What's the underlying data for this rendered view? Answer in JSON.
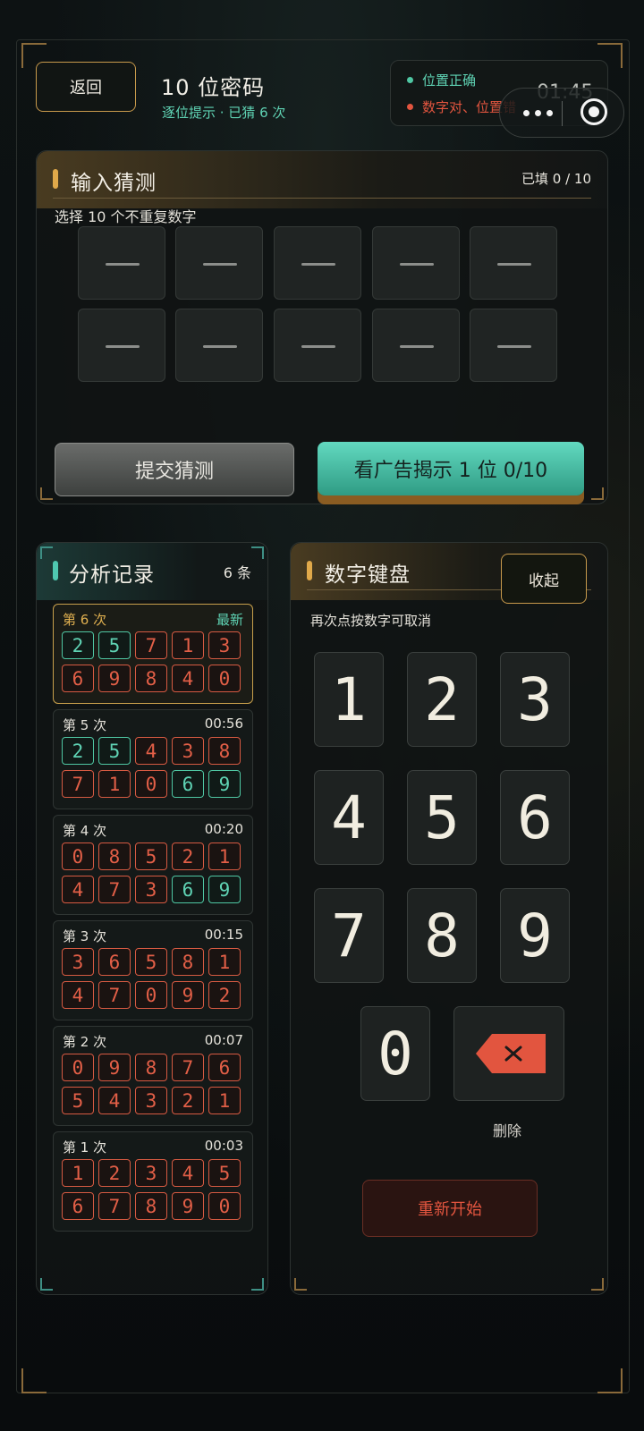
{
  "header": {
    "back_label": "返回",
    "title": "10 位密码",
    "subtitle": "逐位提示 · 已猜 6 次"
  },
  "legend": {
    "correct_label": "位置正确",
    "misplaced_label": "数字对、位置错",
    "correct_color": "#4fc7a3",
    "misplaced_color": "#e2553f"
  },
  "status": {
    "time": "01:45"
  },
  "input_panel": {
    "title": "输入猜测",
    "filled": "已填 0 / 10",
    "hint": "选择 10 个不重复数字",
    "slot_placeholder": "—",
    "submit_label": "提交猜测",
    "ad_label": "看广告揭示 1 位 0/10"
  },
  "history": {
    "title": "分析记录",
    "count": "6 条",
    "entries": [
      {
        "label": "第 6 次",
        "time": "最新",
        "digits": [
          "2",
          "5",
          "7",
          "1",
          "3",
          "6",
          "9",
          "8",
          "4",
          "0"
        ],
        "ok": [
          1,
          1,
          0,
          0,
          0,
          0,
          0,
          0,
          0,
          0
        ]
      },
      {
        "label": "第 5 次",
        "time": "00:56",
        "digits": [
          "2",
          "5",
          "4",
          "3",
          "8",
          "7",
          "1",
          "0",
          "6",
          "9"
        ],
        "ok": [
          1,
          1,
          0,
          0,
          0,
          0,
          0,
          0,
          1,
          1
        ]
      },
      {
        "label": "第 4 次",
        "time": "00:20",
        "digits": [
          "0",
          "8",
          "5",
          "2",
          "1",
          "4",
          "7",
          "3",
          "6",
          "9"
        ],
        "ok": [
          0,
          0,
          0,
          0,
          0,
          0,
          0,
          0,
          1,
          1
        ]
      },
      {
        "label": "第 3 次",
        "time": "00:15",
        "digits": [
          "3",
          "6",
          "5",
          "8",
          "1",
          "4",
          "7",
          "0",
          "9",
          "2"
        ],
        "ok": [
          0,
          0,
          0,
          0,
          0,
          0,
          0,
          0,
          0,
          0
        ]
      },
      {
        "label": "第 2 次",
        "time": "00:07",
        "digits": [
          "0",
          "9",
          "8",
          "7",
          "6",
          "5",
          "4",
          "3",
          "2",
          "1"
        ],
        "ok": [
          0,
          0,
          0,
          0,
          0,
          0,
          0,
          0,
          0,
          0
        ]
      },
      {
        "label": "第 1 次",
        "time": "00:03",
        "digits": [
          "1",
          "2",
          "3",
          "4",
          "5",
          "6",
          "7",
          "8",
          "9",
          "0"
        ],
        "ok": [
          0,
          0,
          0,
          0,
          0,
          0,
          0,
          0,
          0,
          0
        ]
      }
    ]
  },
  "keyboard": {
    "title": "数字键盘",
    "fold_label": "收起",
    "hint": "再次点按数字可取消",
    "keys": [
      "1",
      "2",
      "3",
      "4",
      "5",
      "6",
      "7",
      "8",
      "9",
      "0"
    ],
    "delete_label": "删除",
    "restart_label": "重新开始",
    "delete_icon": "backspace-icon"
  }
}
